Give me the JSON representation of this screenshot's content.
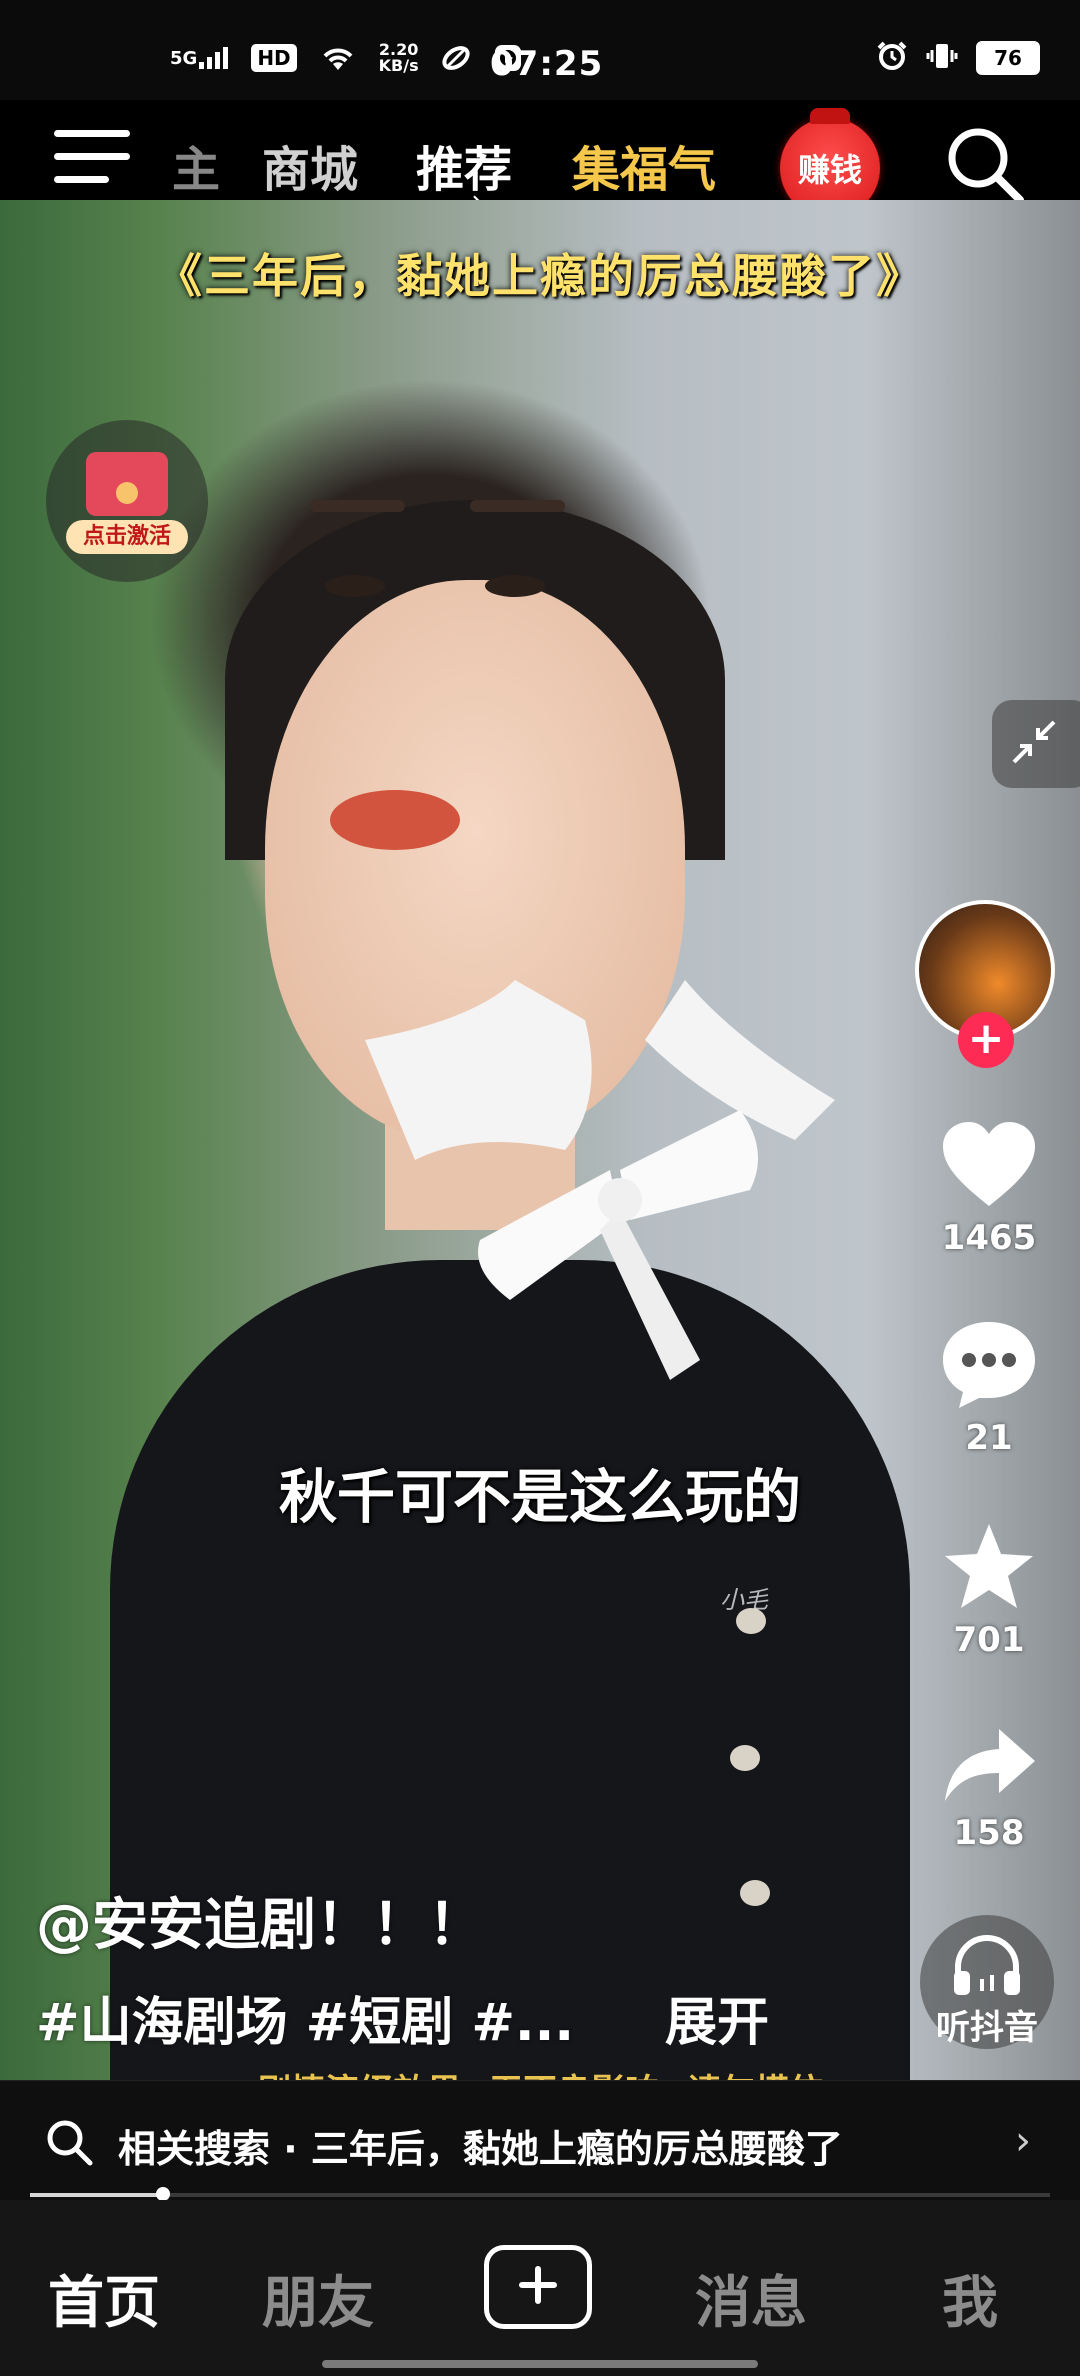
{
  "status_bar": {
    "network": "5G",
    "hd": "HD",
    "speed_value": "2.20",
    "speed_unit": "KB/s",
    "time": "07:25",
    "battery": "76"
  },
  "top_nav": {
    "tabs": [
      {
        "label": "主",
        "state": "partial"
      },
      {
        "label": "商城",
        "state": "normal"
      },
      {
        "label": "推荐",
        "state": "active"
      },
      {
        "label": "集福气",
        "state": "highlight"
      }
    ],
    "earn_badge": "赚钱"
  },
  "video": {
    "title": "《三年后，黏她上瘾的厉总腰酸了》",
    "subtitle": "秋千可不是这么玩的",
    "watermark": "小毛",
    "red_packet_label": "点击激活",
    "disclaimer": "剧情演绎效果 无不良影响 请勿模仿"
  },
  "actions": {
    "likes": "1465",
    "comments": "21",
    "favorites": "701",
    "shares": "158",
    "listen_label": "听抖音"
  },
  "info": {
    "author": "@安安追剧！！！",
    "tags": "#山海剧场 #短剧 #...",
    "expand": "展开"
  },
  "related_search": {
    "text": "相关搜索 · 三年后，黏她上瘾的厉总腰酸了"
  },
  "playback": {
    "progress_fraction": 0.13
  },
  "tab_bar": {
    "home": "首页",
    "friends": "朋友",
    "messages": "消息",
    "me": "我"
  },
  "colors": {
    "accent_red": "#fe2c55",
    "title_gold": "#ffe26b",
    "disclaimer_gold": "#e8c34f"
  }
}
